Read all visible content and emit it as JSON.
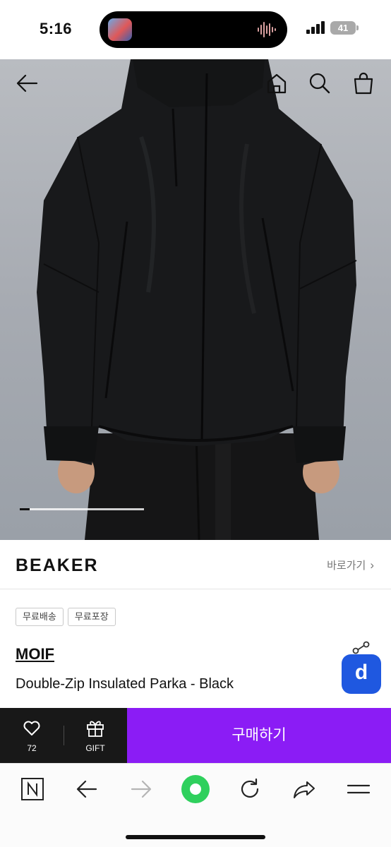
{
  "status_bar": {
    "time": "5:16",
    "battery": "41",
    "island_icons": [
      "music-avatar-icon",
      "audio-wave-icon"
    ],
    "indicators": [
      "signal-icon",
      "battery-icon"
    ]
  },
  "hero": {
    "icons": [
      "back-arrow-icon",
      "home-icon",
      "search-icon",
      "shopping-bag-icon"
    ],
    "carousel_progress": 0.08
  },
  "brand_row": {
    "logo": "BEAKER",
    "link_label": "바로가기",
    "link_icon": "chevron-right-icon"
  },
  "product": {
    "tags": [
      "무료배송",
      "무료포장"
    ],
    "brand": "MOIF",
    "name": "Double-Zip Insulated Parka - Black",
    "badge_letter": "d"
  },
  "purchase_bar": {
    "like_count": "72",
    "gift_label": "GIFT",
    "buy_label": "구매하기",
    "buy_color": "#8b1cf5"
  },
  "browser_toolbar": {
    "icons": [
      "naver-n-icon",
      "back-arrow-icon",
      "forward-arrow-icon",
      "green-circle-icon",
      "refresh-icon",
      "share-icon",
      "menu-icon"
    ],
    "accent": "#2fd05d"
  }
}
